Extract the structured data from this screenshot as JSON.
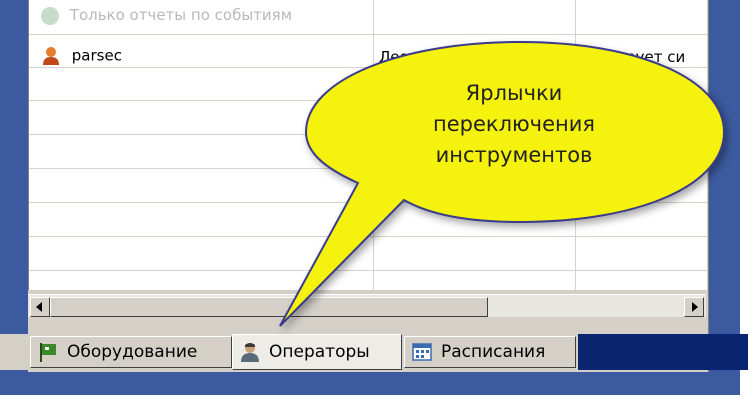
{
  "list": {
    "faded_row": "Только отчеты по событиям",
    "row_user": "parsec",
    "row_col2": "Леонид С",
    "row_col3": "Тестирует си"
  },
  "tabs": [
    {
      "label": "Оборудование",
      "icon": "flag-icon"
    },
    {
      "label": "Операторы",
      "icon": "operator-icon",
      "active": true
    },
    {
      "label": "Расписания",
      "icon": "calendar-icon"
    }
  ],
  "callout": {
    "lines": [
      "Ярлычки",
      "переключения",
      "инструментов"
    ]
  },
  "colors": {
    "callout_fill": "#f5f20c",
    "active_tab": "#eeece7",
    "tab_strip_dark": "#0a2470",
    "window_blue": "#3b5a9f"
  }
}
